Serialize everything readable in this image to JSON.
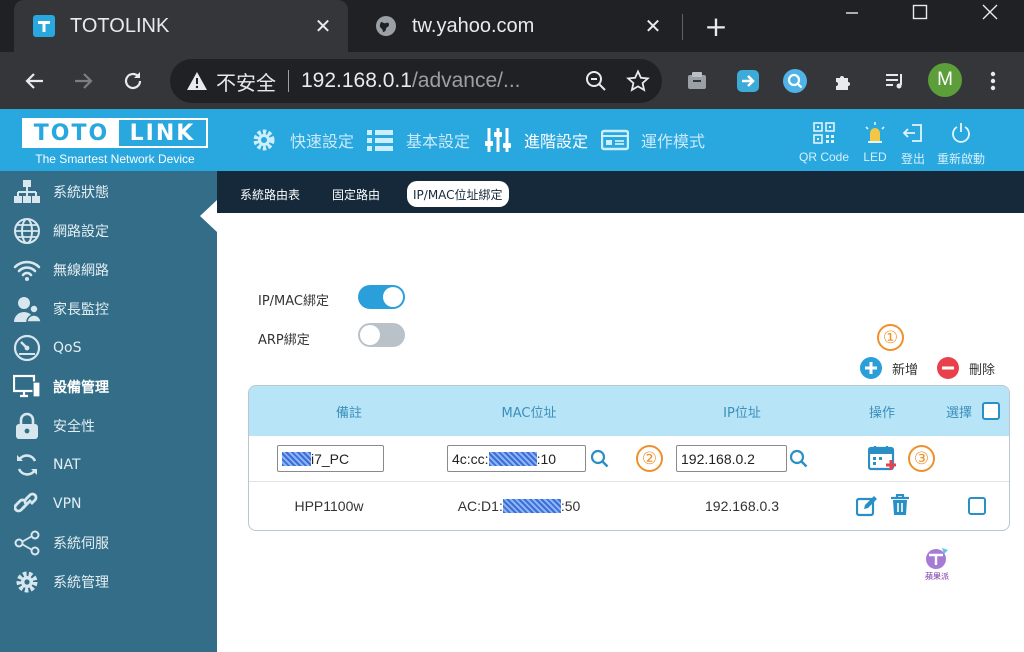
{
  "browser": {
    "tabs": [
      {
        "title": "TOTOLINK",
        "close": "✕"
      },
      {
        "title": "tw.yahoo.com",
        "close": "✕"
      }
    ],
    "new_tab": "+",
    "omnibox": {
      "security_text": "不安全",
      "url_host": "192.168.0.1",
      "url_path": "/advance/..."
    },
    "profile_initial": "M",
    "window_controls": [
      "minimize-icon",
      "maximize-icon",
      "close-icon"
    ]
  },
  "brand": {
    "logo_left": "TOTO",
    "logo_right": "LINK",
    "tagline": "The Smartest Network Device"
  },
  "topnav": [
    {
      "label": "快速設定",
      "icon": "gear-icon",
      "active": false
    },
    {
      "label": "基本設定",
      "icon": "list-icon",
      "active": false
    },
    {
      "label": "進階設定",
      "icon": "sliders-icon",
      "active": true
    },
    {
      "label": "運作模式",
      "icon": "mode-icon",
      "active": false
    }
  ],
  "tools": [
    {
      "label": "QR Code",
      "icon": "qr-code-icon"
    },
    {
      "label": "LED",
      "icon": "led-icon"
    },
    {
      "label": "登出",
      "icon": "logout-icon"
    },
    {
      "label": "重新啟動",
      "icon": "power-icon"
    }
  ],
  "sidebar": {
    "items": [
      {
        "label": "系統狀態",
        "icon": "network-status-icon"
      },
      {
        "label": "網路設定",
        "icon": "globe-icon"
      },
      {
        "label": "無線網路",
        "icon": "wifi-icon"
      },
      {
        "label": "家長監控",
        "icon": "parental-icon"
      },
      {
        "label": "QoS",
        "icon": "gauge-icon"
      },
      {
        "label": "設備管理",
        "icon": "monitor-icon",
        "active": true
      },
      {
        "label": "安全性",
        "icon": "lock-icon"
      },
      {
        "label": "NAT",
        "icon": "refresh-icon"
      },
      {
        "label": "VPN",
        "icon": "link-icon"
      },
      {
        "label": "系統伺服",
        "icon": "share-icon"
      },
      {
        "label": "系統管理",
        "icon": "cog-icon"
      }
    ]
  },
  "subtabs": [
    {
      "label": "系統路由表",
      "active": false
    },
    {
      "label": "固定路由",
      "active": false
    },
    {
      "label": "IP/MAC位址綁定",
      "active": true
    }
  ],
  "settings": {
    "ip_mac_binding": {
      "label": "IP/MAC綁定",
      "enabled": true
    },
    "arp_binding": {
      "label": "ARP綁定",
      "enabled": false
    }
  },
  "annotations": [
    "①",
    "②",
    "③"
  ],
  "actions": {
    "add_label": "新增",
    "delete_label": "刪除"
  },
  "table": {
    "headers": {
      "note": "備註",
      "mac": "MAC位址",
      "ip": "IP位址",
      "operation": "操作",
      "select": "選擇"
    },
    "input_row": {
      "note_suffix": "i7_PC",
      "mac_prefix": "4c:cc:",
      "mac_suffix": ":10",
      "ip": "192.168.0.2"
    },
    "rows": [
      {
        "note": "HPP1100w",
        "mac_prefix": "AC:D1:",
        "mac_suffix": ":50",
        "ip": "192.168.0.3"
      }
    ]
  },
  "watermark": "蘋果派",
  "colors": {
    "header_blue": "#29a7df",
    "sidebar": "#336d88",
    "subtab_bar": "#15293a",
    "table_head": "#b8e4f7",
    "toggle_on": "#2b9fd9",
    "toggle_off": "#b9c2c9",
    "add": "#2b9fd9",
    "delete": "#e8414b",
    "annotation": "#f0902c"
  }
}
